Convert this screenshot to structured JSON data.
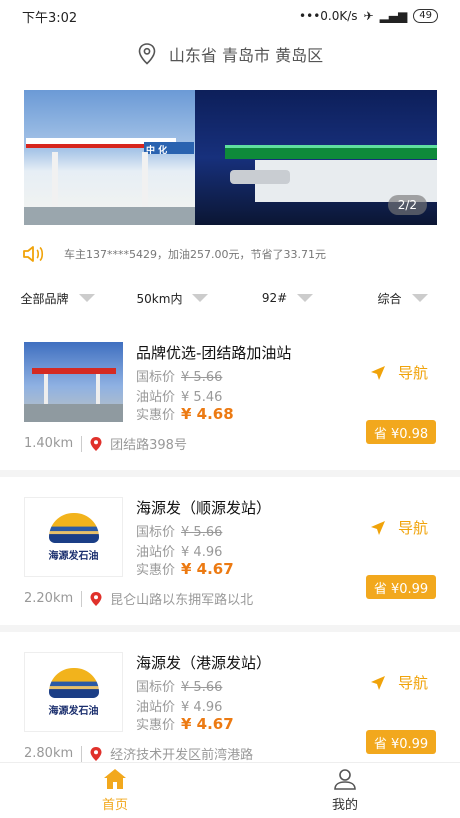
{
  "status": {
    "time": "下午3:02",
    "speed": "0.0K/s",
    "battery": "49"
  },
  "location": {
    "text": "山东省 青岛市 黄岛区"
  },
  "banner": {
    "indicator": "2/2",
    "sign": "中 化"
  },
  "notice": {
    "text": "车主137****5429，加油257.00元，节省了33.71元"
  },
  "filters": [
    "全部品牌",
    "50km内",
    "92#",
    "综合"
  ],
  "price_labels": {
    "national": "国标价",
    "station": "油站价",
    "deal": "实惠价"
  },
  "nav_label": "导航",
  "stations": [
    {
      "name": "品牌优选-团结路加油站",
      "national": "¥ 5.66",
      "station": "¥ 5.46",
      "deal": "¥ 4.68",
      "save": "省 ¥0.98",
      "distance": "1.40km",
      "address": "团结路398号"
    },
    {
      "name": "海源发（顺源发站）",
      "national": "¥ 5.66",
      "station": "¥ 4.96",
      "deal": "¥ 4.67",
      "save": "省 ¥0.99",
      "distance": "2.20km",
      "address": "昆仑山路以东拥军路以北",
      "logo": "海源发石油"
    },
    {
      "name": "海源发（港源发站）",
      "national": "¥ 5.66",
      "station": "¥ 4.96",
      "deal": "¥ 4.67",
      "save": "省 ¥0.99",
      "distance": "2.80km",
      "address": "经济技术开发区前湾港路",
      "logo": "海源发石油"
    }
  ],
  "tabs": [
    {
      "label": "首页"
    },
    {
      "label": "我的"
    }
  ],
  "colors": {
    "accent": "#f2a81d",
    "deal": "#ec7a12"
  }
}
